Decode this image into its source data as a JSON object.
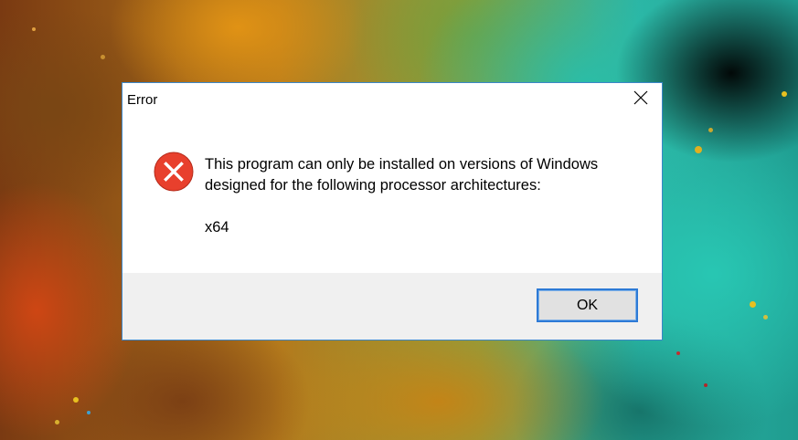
{
  "dialog": {
    "title": "Error",
    "close_icon": "close-icon",
    "icon": "error-icon",
    "message_lines": [
      "This program can only be installed on versions of Windows",
      "designed for the following processor architectures:"
    ],
    "architecture": "x64",
    "ok_label": "OK"
  },
  "colors": {
    "error_red": "#e8402d",
    "button_border": "#2d7ad6",
    "footer_bg": "#f0f0f0",
    "window_border": "#3b86c8"
  }
}
